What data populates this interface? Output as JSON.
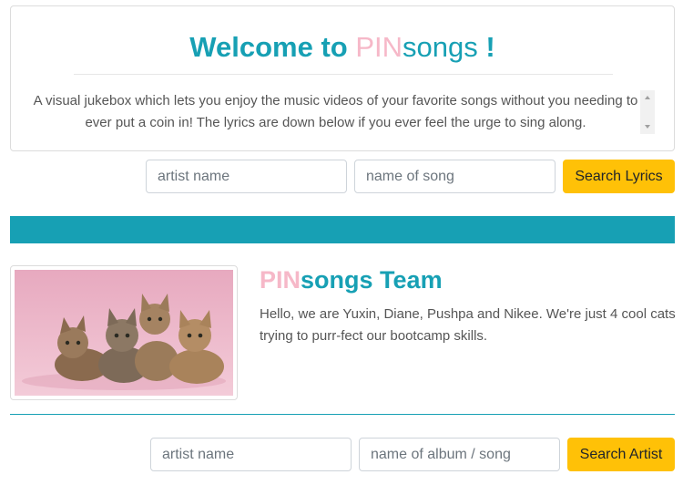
{
  "welcome": {
    "title_welcome": "Welcome to",
    "title_pin": "PIN",
    "title_songs": "songs",
    "title_bang": "!",
    "description": "A visual jukebox which lets you enjoy the music videos of your favorite songs without you needing to ever put a coin in! The lyrics are down below if you ever feel the urge to sing along."
  },
  "lyrics_search": {
    "artist_placeholder": "artist name",
    "song_placeholder": "name of song",
    "button_label": "Search Lyrics"
  },
  "team": {
    "title_pin": "PIN",
    "title_songs": "songs",
    "title_team": "Team",
    "image_alt": "four kittens",
    "description": "Hello, we are Yuxin, Diane, Pushpa and Nikee. We're just 4 cool cats trying to purr-fect our bootcamp skills."
  },
  "artist_search": {
    "artist_placeholder": "artist name",
    "album_placeholder": "name of album / song",
    "button_label": "Search Artist"
  },
  "colors": {
    "accent_teal": "#17a0b4",
    "accent_pink": "#f6b8c8",
    "button_yellow": "#ffc107"
  }
}
